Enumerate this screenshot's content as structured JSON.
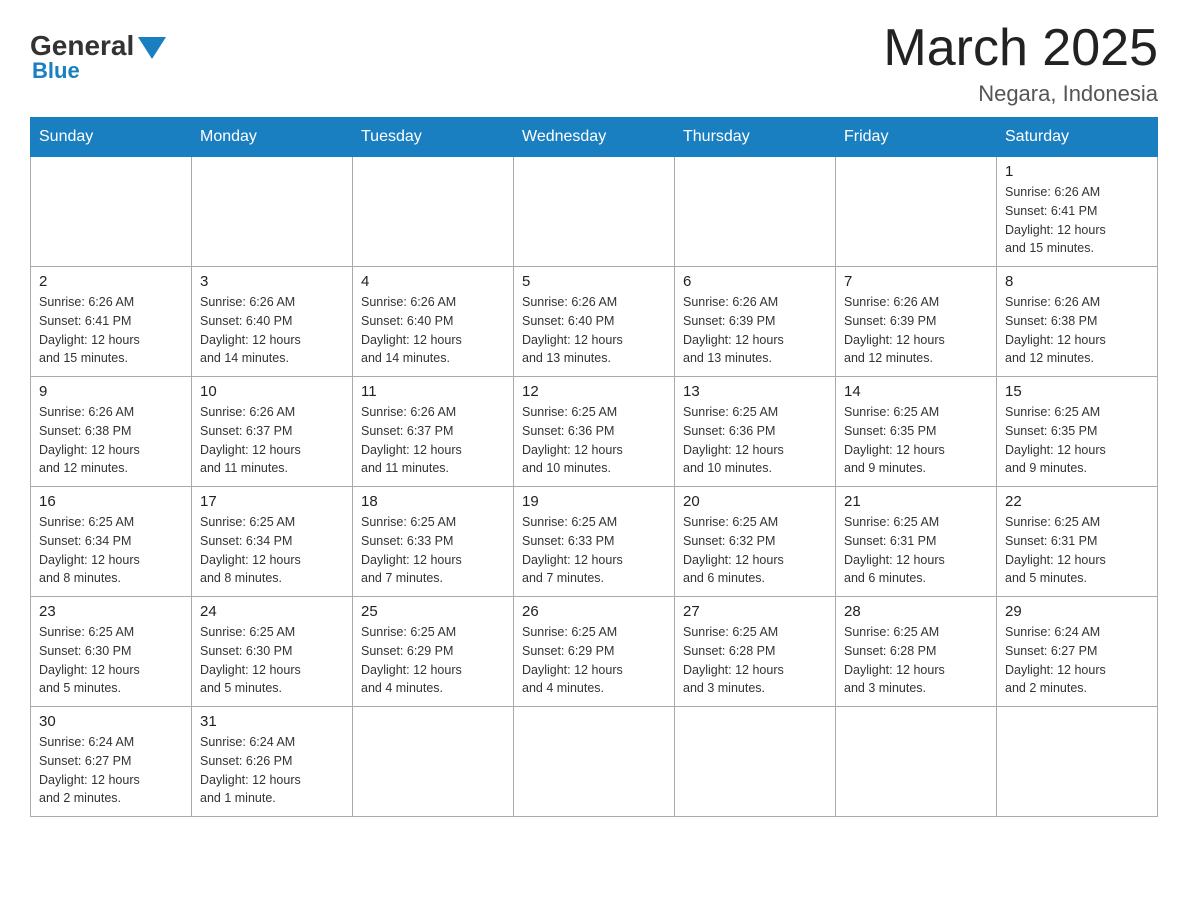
{
  "header": {
    "logo_general": "General",
    "logo_blue": "Blue",
    "title": "March 2025",
    "location": "Negara, Indonesia"
  },
  "weekdays": [
    "Sunday",
    "Monday",
    "Tuesday",
    "Wednesday",
    "Thursday",
    "Friday",
    "Saturday"
  ],
  "weeks": [
    [
      {
        "day": "",
        "info": ""
      },
      {
        "day": "",
        "info": ""
      },
      {
        "day": "",
        "info": ""
      },
      {
        "day": "",
        "info": ""
      },
      {
        "day": "",
        "info": ""
      },
      {
        "day": "",
        "info": ""
      },
      {
        "day": "1",
        "info": "Sunrise: 6:26 AM\nSunset: 6:41 PM\nDaylight: 12 hours\nand 15 minutes."
      }
    ],
    [
      {
        "day": "2",
        "info": "Sunrise: 6:26 AM\nSunset: 6:41 PM\nDaylight: 12 hours\nand 15 minutes."
      },
      {
        "day": "3",
        "info": "Sunrise: 6:26 AM\nSunset: 6:40 PM\nDaylight: 12 hours\nand 14 minutes."
      },
      {
        "day": "4",
        "info": "Sunrise: 6:26 AM\nSunset: 6:40 PM\nDaylight: 12 hours\nand 14 minutes."
      },
      {
        "day": "5",
        "info": "Sunrise: 6:26 AM\nSunset: 6:40 PM\nDaylight: 12 hours\nand 13 minutes."
      },
      {
        "day": "6",
        "info": "Sunrise: 6:26 AM\nSunset: 6:39 PM\nDaylight: 12 hours\nand 13 minutes."
      },
      {
        "day": "7",
        "info": "Sunrise: 6:26 AM\nSunset: 6:39 PM\nDaylight: 12 hours\nand 12 minutes."
      },
      {
        "day": "8",
        "info": "Sunrise: 6:26 AM\nSunset: 6:38 PM\nDaylight: 12 hours\nand 12 minutes."
      }
    ],
    [
      {
        "day": "9",
        "info": "Sunrise: 6:26 AM\nSunset: 6:38 PM\nDaylight: 12 hours\nand 12 minutes."
      },
      {
        "day": "10",
        "info": "Sunrise: 6:26 AM\nSunset: 6:37 PM\nDaylight: 12 hours\nand 11 minutes."
      },
      {
        "day": "11",
        "info": "Sunrise: 6:26 AM\nSunset: 6:37 PM\nDaylight: 12 hours\nand 11 minutes."
      },
      {
        "day": "12",
        "info": "Sunrise: 6:25 AM\nSunset: 6:36 PM\nDaylight: 12 hours\nand 10 minutes."
      },
      {
        "day": "13",
        "info": "Sunrise: 6:25 AM\nSunset: 6:36 PM\nDaylight: 12 hours\nand 10 minutes."
      },
      {
        "day": "14",
        "info": "Sunrise: 6:25 AM\nSunset: 6:35 PM\nDaylight: 12 hours\nand 9 minutes."
      },
      {
        "day": "15",
        "info": "Sunrise: 6:25 AM\nSunset: 6:35 PM\nDaylight: 12 hours\nand 9 minutes."
      }
    ],
    [
      {
        "day": "16",
        "info": "Sunrise: 6:25 AM\nSunset: 6:34 PM\nDaylight: 12 hours\nand 8 minutes."
      },
      {
        "day": "17",
        "info": "Sunrise: 6:25 AM\nSunset: 6:34 PM\nDaylight: 12 hours\nand 8 minutes."
      },
      {
        "day": "18",
        "info": "Sunrise: 6:25 AM\nSunset: 6:33 PM\nDaylight: 12 hours\nand 7 minutes."
      },
      {
        "day": "19",
        "info": "Sunrise: 6:25 AM\nSunset: 6:33 PM\nDaylight: 12 hours\nand 7 minutes."
      },
      {
        "day": "20",
        "info": "Sunrise: 6:25 AM\nSunset: 6:32 PM\nDaylight: 12 hours\nand 6 minutes."
      },
      {
        "day": "21",
        "info": "Sunrise: 6:25 AM\nSunset: 6:31 PM\nDaylight: 12 hours\nand 6 minutes."
      },
      {
        "day": "22",
        "info": "Sunrise: 6:25 AM\nSunset: 6:31 PM\nDaylight: 12 hours\nand 5 minutes."
      }
    ],
    [
      {
        "day": "23",
        "info": "Sunrise: 6:25 AM\nSunset: 6:30 PM\nDaylight: 12 hours\nand 5 minutes."
      },
      {
        "day": "24",
        "info": "Sunrise: 6:25 AM\nSunset: 6:30 PM\nDaylight: 12 hours\nand 5 minutes."
      },
      {
        "day": "25",
        "info": "Sunrise: 6:25 AM\nSunset: 6:29 PM\nDaylight: 12 hours\nand 4 minutes."
      },
      {
        "day": "26",
        "info": "Sunrise: 6:25 AM\nSunset: 6:29 PM\nDaylight: 12 hours\nand 4 minutes."
      },
      {
        "day": "27",
        "info": "Sunrise: 6:25 AM\nSunset: 6:28 PM\nDaylight: 12 hours\nand 3 minutes."
      },
      {
        "day": "28",
        "info": "Sunrise: 6:25 AM\nSunset: 6:28 PM\nDaylight: 12 hours\nand 3 minutes."
      },
      {
        "day": "29",
        "info": "Sunrise: 6:24 AM\nSunset: 6:27 PM\nDaylight: 12 hours\nand 2 minutes."
      }
    ],
    [
      {
        "day": "30",
        "info": "Sunrise: 6:24 AM\nSunset: 6:27 PM\nDaylight: 12 hours\nand 2 minutes."
      },
      {
        "day": "31",
        "info": "Sunrise: 6:24 AM\nSunset: 6:26 PM\nDaylight: 12 hours\nand 1 minute."
      },
      {
        "day": "",
        "info": ""
      },
      {
        "day": "",
        "info": ""
      },
      {
        "day": "",
        "info": ""
      },
      {
        "day": "",
        "info": ""
      },
      {
        "day": "",
        "info": ""
      }
    ]
  ]
}
